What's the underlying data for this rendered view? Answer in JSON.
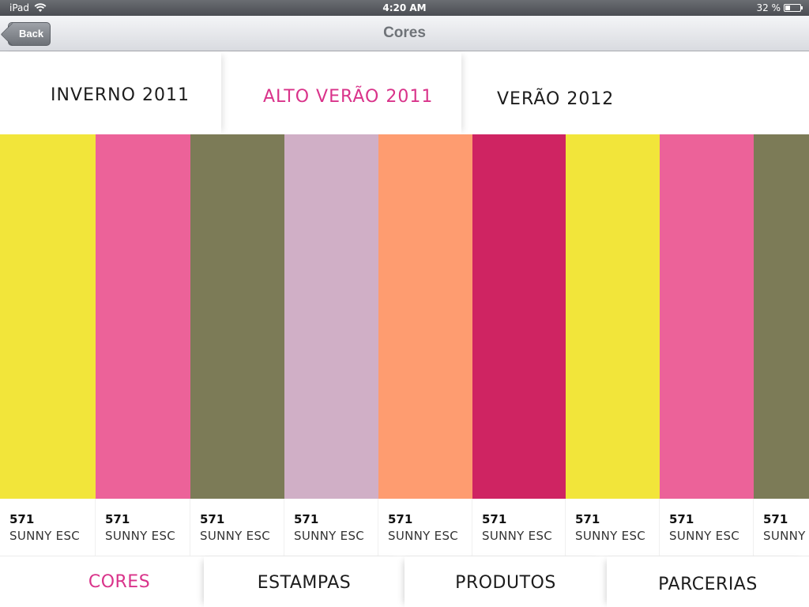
{
  "status_bar": {
    "device": "iPad",
    "time": "4:20 AM",
    "battery_text": "32 %",
    "battery_level": 0.32
  },
  "nav_bar": {
    "back_label": "Back",
    "title": "Cores"
  },
  "seasons": {
    "active_index": 1,
    "active_color": "#d9338a",
    "items": [
      {
        "label": "INVERNO 2011"
      },
      {
        "label": "ALTO VERÃO 2011"
      },
      {
        "label": "VERÃO 2012"
      }
    ]
  },
  "swatches": [
    {
      "color": "#f2e53a",
      "code": "571",
      "name": "SUNNY ESC"
    },
    {
      "color": "#ec6299",
      "code": "571",
      "name": "SUNNY ESC"
    },
    {
      "color": "#7c7b57",
      "code": "571",
      "name": "SUNNY ESC"
    },
    {
      "color": "#d0afc6",
      "code": "571",
      "name": "SUNNY ESC"
    },
    {
      "color": "#fe9c70",
      "code": "571",
      "name": "SUNNY ESC"
    },
    {
      "color": "#cf2462",
      "code": "571",
      "name": "SUNNY ESC"
    },
    {
      "color": "#f2e53a",
      "code": "571",
      "name": "SUNNY ESC"
    },
    {
      "color": "#ec6299",
      "code": "571",
      "name": "SUNNY ESC"
    },
    {
      "color": "#7c7b57",
      "code": "571",
      "name": "SUNNY ESC"
    }
  ],
  "bottom_tabs": {
    "active_index": 0,
    "items": [
      {
        "label": "CORES"
      },
      {
        "label": "ESTAMPAS"
      },
      {
        "label": "PRODUTOS"
      },
      {
        "label": "PARCERIAS"
      }
    ]
  }
}
